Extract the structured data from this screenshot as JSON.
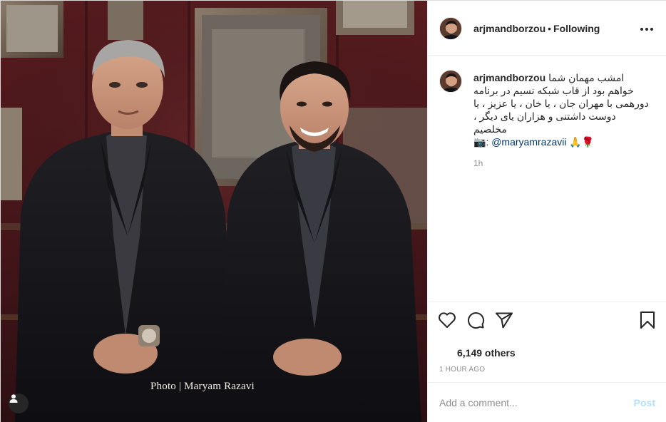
{
  "post": {
    "username": "arjmandborzou",
    "separator": "•",
    "follow_status": "Following",
    "photo_credit": "Photo | Maryam Razavi",
    "caption": {
      "username": "arjmandborzou",
      "first_line": "امشب مهمان شما",
      "lines": [
        "خواهم بود از قاب شبکه نسیم در برنامه",
        "دورهمی با مهران جان ، یا خان ، یا عزیز ، یا",
        "دوست داشتنی و هزاران یای دیگر ،",
        "مخلصیم"
      ],
      "camera_emoji": "📷",
      "mention_prefix": ":",
      "mention": "@maryamrazavii",
      "trailing_emoji": "🙏🌹",
      "time": "1h"
    },
    "likes": "6,149 others",
    "time_ago": "1 HOUR AGO",
    "comment": {
      "placeholder": "Add a comment...",
      "post_label": "Post"
    }
  },
  "icons": {
    "more": "more-options-icon",
    "like": "heart-icon",
    "comment": "comment-icon",
    "share": "paper-plane-icon",
    "save": "bookmark-icon",
    "tag": "user-tag-icon"
  },
  "colors": {
    "link": "#00376b",
    "muted": "#8e8e8e",
    "post_disabled": "#b2dffc",
    "border": "#efefef"
  }
}
